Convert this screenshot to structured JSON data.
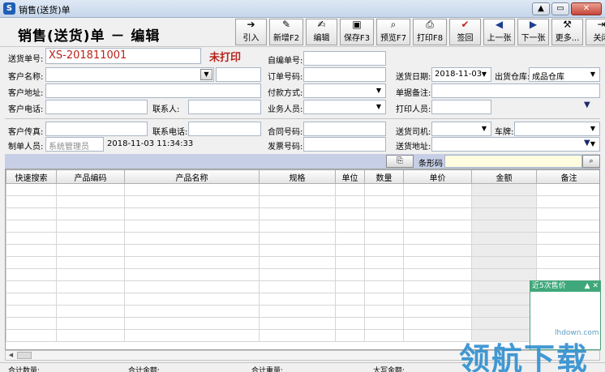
{
  "window": {
    "title": "销售(送货)单",
    "controls": [
      "▲",
      "▭",
      "✕"
    ]
  },
  "header": {
    "page_title": "销售(送货)单 － 编辑"
  },
  "toolbar": [
    {
      "name": "import-button",
      "icon": "arrow-right-icon",
      "glyph": "➔",
      "label": "引入"
    },
    {
      "name": "new-button",
      "icon": "new-document-icon",
      "glyph": "✎",
      "label": "新增F2"
    },
    {
      "name": "edit-button",
      "icon": "edit-document-icon",
      "glyph": "✍",
      "label": "编辑"
    },
    {
      "name": "save-button",
      "icon": "floppy-disk-icon",
      "glyph": "▣",
      "label": "保存F3"
    },
    {
      "name": "preview-button",
      "icon": "magnifier-document-icon",
      "glyph": "⌕",
      "label": "预览F7"
    },
    {
      "name": "print-button",
      "icon": "printer-icon",
      "glyph": "⎙",
      "label": "打印F8"
    },
    {
      "name": "sign-back-button",
      "icon": "checkmark-icon",
      "glyph": "✔",
      "label": "签回"
    },
    {
      "name": "previous-button",
      "icon": "triangle-left-icon",
      "glyph": "◀",
      "label": "上一张"
    },
    {
      "name": "next-button",
      "icon": "triangle-right-icon",
      "glyph": "▶",
      "label": "下一张"
    },
    {
      "name": "more-button",
      "icon": "tools-icon",
      "glyph": "⚒",
      "label": "更多..."
    },
    {
      "name": "close-button",
      "icon": "exit-door-icon",
      "glyph": "⇥",
      "label": "关闭"
    }
  ],
  "form": {
    "order_no_label": "送货单号:",
    "order_no_value": "XS-201811001",
    "status": "未打印",
    "custom_no_label": "自编单号:",
    "customer_name_label": "客户名称:",
    "order_ref_label": "订单号码:",
    "delivery_date_label": "送货日期:",
    "delivery_date_value": "2018-11-03",
    "warehouse_label": "出货仓库:",
    "warehouse_value": "成品仓库",
    "customer_address_label": "客户地址:",
    "payment_label": "付款方式:",
    "remarks_label": "单据备注:",
    "customer_phone_label": "客户电话:",
    "contact_label": "联系人:",
    "salesman_label": "业务人员:",
    "printer_label": "打印人员:",
    "customer_fax_label": "客户传真:",
    "contact_phone_label": "联系电话:",
    "contract_label": "合同号码:",
    "driver_label": "送货司机:",
    "plate_label": "车牌:",
    "creator_label": "制单人员:",
    "creator_value": "系统管理员",
    "created_time": "2018-11-03 11:34:33",
    "invoice_label": "发票号码:",
    "delivery_address_label": "送货地址:"
  },
  "barcode": {
    "label": "条形码"
  },
  "grid": {
    "columns": [
      "快速搜索",
      "产品编码",
      "产品名称",
      "规格",
      "单位",
      "数量",
      "单价",
      "金额",
      "备注"
    ],
    "row_count": 13
  },
  "totals": {
    "qty_label": "合计数量:",
    "amount_label": "合计金额:",
    "weight_label": "合计重量:",
    "upper_amount_label": "大写金额:"
  },
  "recent_price": {
    "title": "近5次售价",
    "controls": "▲ ✕"
  },
  "watermark": {
    "url": "lhdown.com",
    "text": "领航下载"
  }
}
